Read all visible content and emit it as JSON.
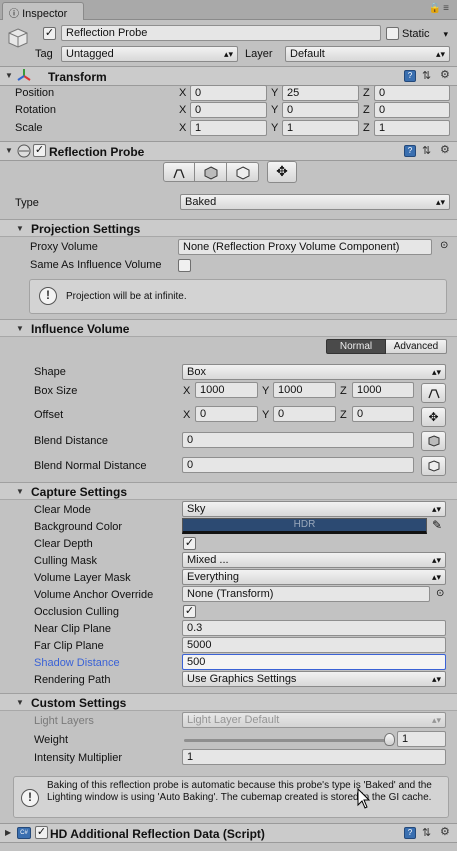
{
  "tab": {
    "title": "Inspector"
  },
  "object": {
    "name": "Reflection Probe",
    "static_label": "Static",
    "tag_label": "Tag",
    "tag_value": "Untagged",
    "layer_label": "Layer",
    "layer_value": "Default"
  },
  "transform": {
    "title": "Transform",
    "rows": [
      {
        "label": "Position",
        "x": "0",
        "y": "25",
        "z": "0"
      },
      {
        "label": "Rotation",
        "x": "0",
        "y": "0",
        "z": "0"
      },
      {
        "label": "Scale",
        "x": "1",
        "y": "1",
        "z": "1"
      }
    ]
  },
  "probe": {
    "title": "Reflection Probe",
    "type_label": "Type",
    "type_value": "Baked"
  },
  "projection": {
    "title": "Projection Settings",
    "proxy_label": "Proxy Volume",
    "proxy_value": "None (Reflection Proxy Volume Component)",
    "same_label": "Same As Influence Volume",
    "info": "Projection will be at infinite."
  },
  "influence": {
    "title": "Influence Volume",
    "mode_normal": "Normal",
    "mode_advanced": "Advanced",
    "shape_label": "Shape",
    "shape_value": "Box",
    "boxsize_label": "Box Size",
    "box_x": "1000",
    "box_y": "1000",
    "box_z": "1000",
    "offset_label": "Offset",
    "off_x": "0",
    "off_y": "0",
    "off_z": "0",
    "blend_label": "Blend Distance",
    "blend_value": "0",
    "blendnormal_label": "Blend Normal Distance",
    "blendnormal_value": "0"
  },
  "capture": {
    "title": "Capture Settings",
    "clear_mode_label": "Clear Mode",
    "clear_mode_value": "Sky",
    "bg_label": "Background Color",
    "bg_value": "HDR",
    "bg_color": "#2c4a72",
    "clear_depth_label": "Clear Depth",
    "culling_label": "Culling Mask",
    "culling_value": "Mixed ...",
    "volume_layer_label": "Volume Layer Mask",
    "volume_layer_value": "Everything",
    "anchor_label": "Volume Anchor Override",
    "anchor_value": "None (Transform)",
    "occlusion_label": "Occlusion Culling",
    "near_label": "Near Clip Plane",
    "near_value": "0.3",
    "far_label": "Far Clip Plane",
    "far_value": "5000",
    "shadow_label": "Shadow Distance",
    "shadow_value": "500",
    "render_label": "Rendering Path",
    "render_value": "Use Graphics Settings"
  },
  "custom": {
    "title": "Custom Settings",
    "light_layers_label": "Light Layers",
    "light_layers_value": "Light Layer Default",
    "weight_label": "Weight",
    "weight_value": "1",
    "weight_fraction": 1.0,
    "intensity_label": "Intensity Multiplier",
    "intensity_value": "1"
  },
  "baking_info": "Baking of this reflection probe is automatic because this probe's type is 'Baked' and the Lighting window is using 'Auto Baking'. The cubemap created is stored in the GI cache.",
  "hd": {
    "title": "HD Additional Reflection Data (Script)"
  },
  "colors": {
    "selected_blue": "#3a62d6",
    "toggle_active": "#4a4a4a"
  }
}
